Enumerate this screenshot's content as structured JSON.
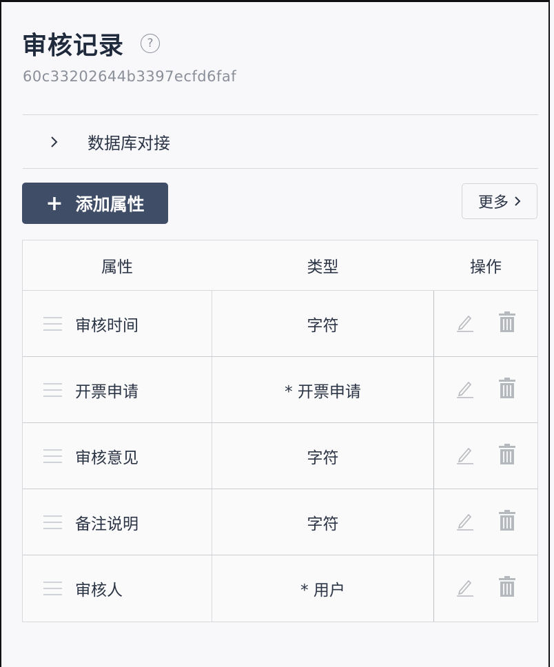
{
  "header": {
    "title": "审核记录",
    "help_icon": "help-circle-icon",
    "help_glyph": "?",
    "id_text": "60c33202644b3397ecfd6faf"
  },
  "collapse": {
    "label": "数据库对接",
    "icon": "chevron-right-icon"
  },
  "toolbar": {
    "add_plus": "+",
    "add_label": "添加属性",
    "more_label": "更多"
  },
  "table": {
    "columns": [
      "属性",
      "类型",
      "操作"
    ],
    "rows": [
      {
        "name": "审核时间",
        "type": "字符"
      },
      {
        "name": "开票申请",
        "type": "* 开票申请"
      },
      {
        "name": "审核意见",
        "type": "字符"
      },
      {
        "name": "备注说明",
        "type": "字符"
      },
      {
        "name": "审核人",
        "type": "* 用户"
      }
    ],
    "row_actions": [
      "edit-icon",
      "delete-icon"
    ]
  },
  "colors": {
    "primary_button": "#3f4d67",
    "text": "#2b3445",
    "muted": "#8a8f99",
    "border": "#d6d8dc",
    "icon_gray": "#b5b8bd"
  }
}
